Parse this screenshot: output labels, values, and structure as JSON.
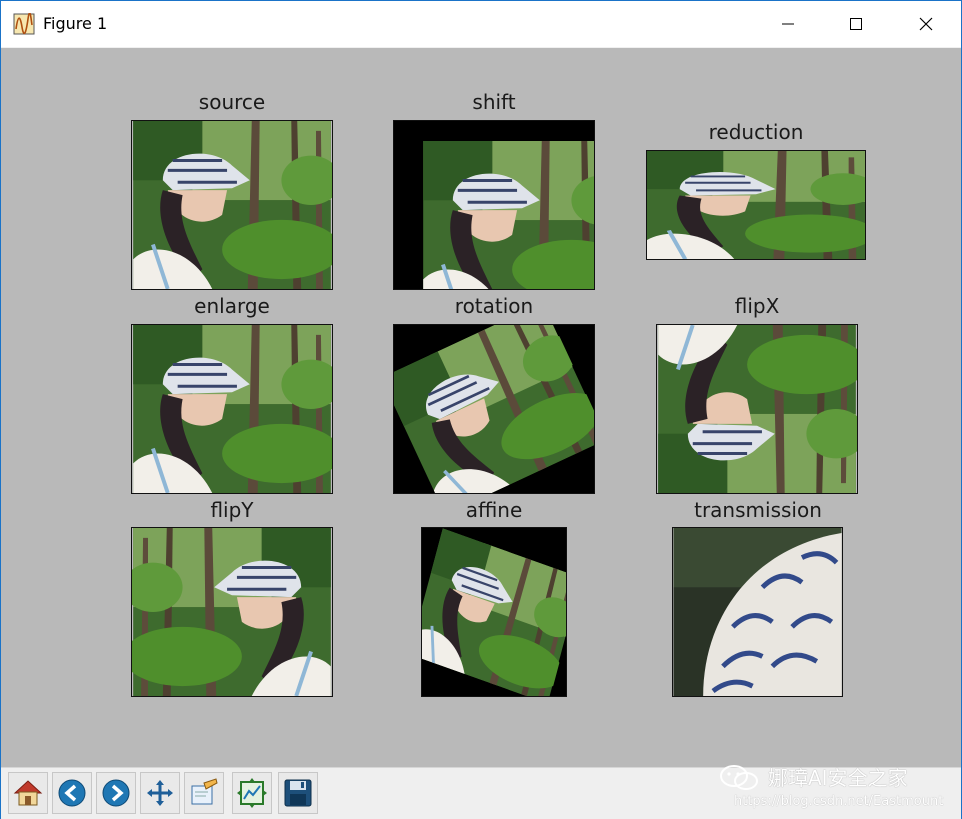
{
  "window": {
    "title": "Figure 1",
    "controls": [
      "minimize",
      "maximize",
      "close"
    ]
  },
  "figure": {
    "panels": [
      {
        "id": "source",
        "title": "source"
      },
      {
        "id": "shift",
        "title": "shift"
      },
      {
        "id": "reduction",
        "title": "reduction"
      },
      {
        "id": "enlarge",
        "title": "enlarge"
      },
      {
        "id": "rotation",
        "title": "rotation"
      },
      {
        "id": "flipX",
        "title": "flipX"
      },
      {
        "id": "flipY",
        "title": "flipY"
      },
      {
        "id": "affine",
        "title": "affine"
      },
      {
        "id": "transmission",
        "title": "transmission"
      }
    ]
  },
  "toolbar": {
    "buttons": [
      {
        "name": "home",
        "icon": "home-icon"
      },
      {
        "name": "back",
        "icon": "back-arrow-icon"
      },
      {
        "name": "forward",
        "icon": "forward-arrow-icon"
      },
      {
        "name": "pan",
        "icon": "move-icon"
      },
      {
        "name": "zoom",
        "icon": "zoom-rect-icon"
      },
      {
        "name": "subplots",
        "icon": "subplots-icon"
      },
      {
        "name": "save",
        "icon": "save-icon"
      }
    ]
  },
  "watermark": {
    "title": "娜璋AI安全之家",
    "url": "https://blog.csdn.net/Eastmount"
  },
  "colors": {
    "canvas_bg": "#b9b9b9",
    "window_border": "#1a73c8"
  }
}
